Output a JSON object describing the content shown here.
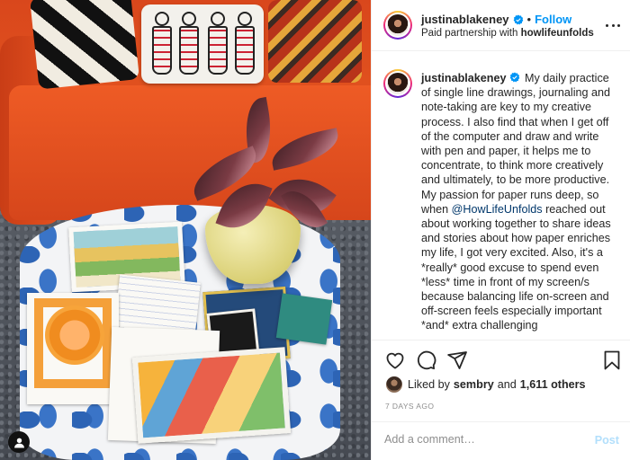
{
  "post": {
    "username": "justinablakeney",
    "follow_label": "Follow",
    "separator": "•",
    "partnership_prefix": "Paid partnership with",
    "partner": "howlifeunfolds",
    "caption_before_mention": "My daily practice of single line drawings, journaling and note-taking are key to my creative process. I also find that when I get off of the computer and draw and write with pen and paper, it helps me to concentrate, to think more creatively and ultimately, to be more productive. My passion for paper runs deep, so when",
    "mention": "@HowLifeUnfolds",
    "caption_after_mention": "reached out about working together to share ideas and stories about how paper enriches my life, I got very excited. Also, it's a *really* good excuse to spend even *less* time in front of my screen/s because balancing life on-screen and off-screen feels especially important *and* extra challenging",
    "liked_by_prefix": "Liked by",
    "liked_by_user": "sembry",
    "liked_by_and": "and",
    "others": "1,611 others",
    "timestamp": "7 DAYS AGO"
  },
  "comment": {
    "placeholder": "Add a comment…",
    "post_label": "Post"
  },
  "icons": {
    "header_more": "more-options-icon",
    "verified": "verified-badge-icon",
    "like": "heart-icon",
    "comment": "comment-icon",
    "share": "paper-plane-icon",
    "save": "bookmark-icon",
    "tag": "user-tag-icon"
  },
  "colors": {
    "link_blue": "#0095f6",
    "mention": "#00376b",
    "muted": "#8e8e8e",
    "post_disabled": "#b2dffc"
  }
}
